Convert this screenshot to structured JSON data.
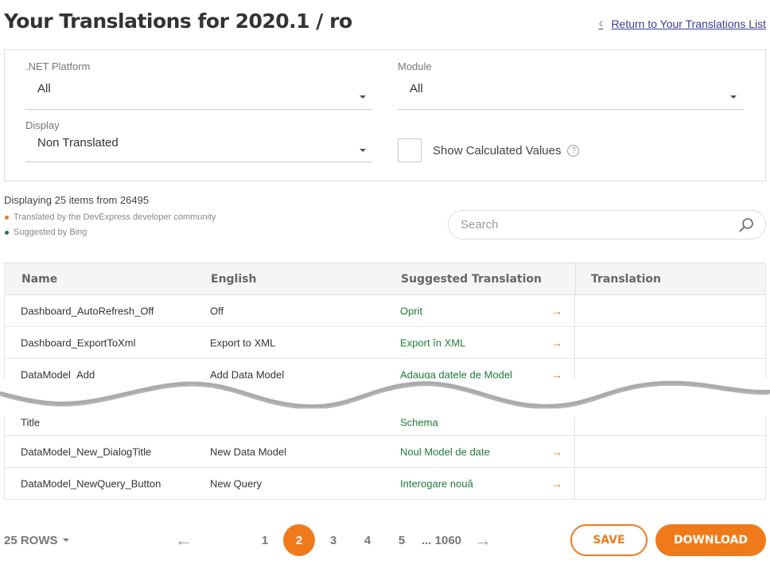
{
  "title": "Your Translations for 2020.1 / ro",
  "back_link": "Return to Your Translations List",
  "filters": {
    "platform": {
      "label": ".NET Platform",
      "value": "All"
    },
    "module": {
      "label": "Module",
      "value": "All"
    },
    "display": {
      "label": "Display",
      "value": "Non Translated"
    },
    "calculated": {
      "label": "Show Calculated Values",
      "checked": false
    }
  },
  "info": "Displaying 25 items from 26495",
  "legend": [
    {
      "text": "Translated by the DevExpress developer community",
      "color": "#f07a1a"
    },
    {
      "text": "Suggested by Bing",
      "color": "#1d7a3a"
    }
  ],
  "search": {
    "placeholder": "Search"
  },
  "table": {
    "headers": [
      "Name",
      "English",
      "Suggested Translation",
      "Translation"
    ],
    "rows": [
      {
        "name": "Dashboard_AutoRefresh_Off",
        "english": "Off",
        "suggested": "Oprit",
        "translation": ""
      },
      {
        "name": "Dashboard_ExportToXml",
        "english": "Export to XML",
        "suggested": "Export în XML",
        "translation": ""
      },
      {
        "name": "DataModel_Add",
        "english": "Add Data Model",
        "suggested": "Adauga datele de Model",
        "translation": ""
      },
      {
        "name": "Title",
        "english": "",
        "suggested": "Schema",
        "translation": ""
      },
      {
        "name": "DataModel_New_DialogTitle",
        "english": "New Data Model",
        "suggested": "Noul Model de date",
        "translation": ""
      },
      {
        "name": "DataModel_NewQuery_Button",
        "english": "New Query",
        "suggested": "Interogare nouă",
        "translation": ""
      }
    ]
  },
  "pager": {
    "rows_label": "25 ROWS",
    "pages": [
      "1",
      "2",
      "3",
      "4",
      "5"
    ],
    "ellipsis": "...",
    "last": "1060",
    "current": "2"
  },
  "buttons": {
    "save": "SAVE",
    "download": "DOWNLOAD"
  },
  "colors": {
    "accent": "#f07a1a",
    "suggested": "#1d7a3a"
  }
}
